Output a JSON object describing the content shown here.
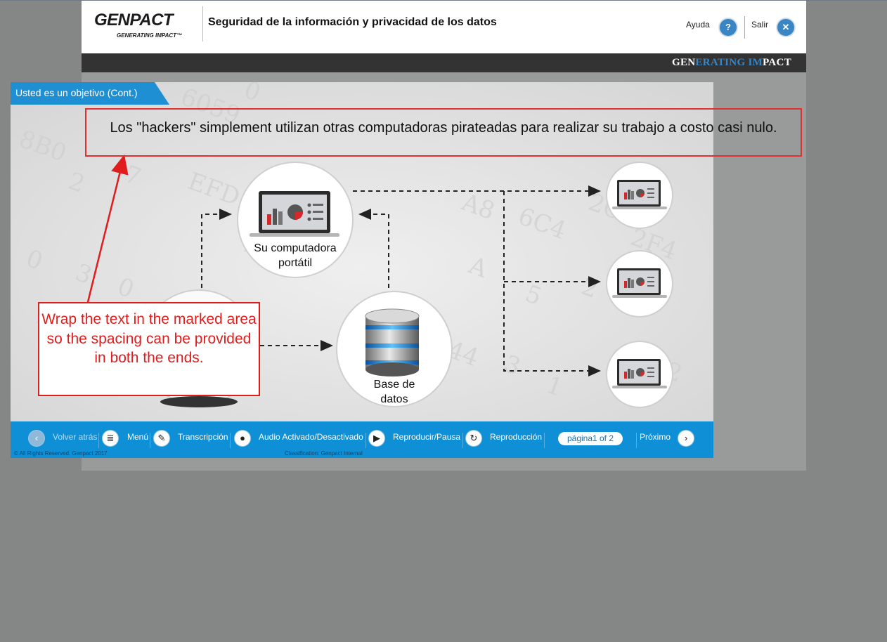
{
  "header": {
    "logo_main": "GENPACT",
    "logo_sub": "GENERATING IMPACT™",
    "course_title": "Seguridad de la información y privacidad de los datos",
    "help_label": "Ayuda",
    "help_glyph": "?",
    "exit_label": "Salir",
    "exit_glyph": "✕"
  },
  "banner": {
    "part1": "GEN",
    "part2": "ERATING ",
    "part3": "IM",
    "part4": "PACT"
  },
  "slide": {
    "tab_title": "Usted es un objetivo (Cont.)",
    "headline": "Los \"hackers\" simplement utilizan otras computadoras pirateadas para realizar su trabajo a costo casi nulo.",
    "laptop_label": "Su computadora portátil",
    "database_label": "Base de datos",
    "background_characters": [
      "6059",
      "0",
      "8B0",
      "2",
      "7",
      "EFD",
      "0",
      "3",
      "0",
      "D",
      "A8",
      "6C4",
      "2CC",
      "2F4",
      "E",
      "A",
      "5",
      "2",
      "4",
      "1",
      "44",
      "3",
      "1",
      "0",
      "2",
      "7"
    ]
  },
  "controls": {
    "back": "Volver atrás",
    "menu": "Menú",
    "transcript": "Transcripción",
    "audio": "Audio Activado/Desactivado",
    "play_pause": "Reproducir/Pausa",
    "replay": "Reproducción",
    "page": "página1 of 2",
    "next": "Próximo",
    "copyright": "© All Rights Reserved. Genpact 2017",
    "classification": "Classification: Genpact Internal"
  },
  "annotation": {
    "text": "Wrap the text in the marked area so the spacing can be provided in both the ends."
  },
  "colors": {
    "accent_blue": "#0e8fd6",
    "annotation_red": "#e01c1c",
    "dark_bar": "#333333"
  }
}
